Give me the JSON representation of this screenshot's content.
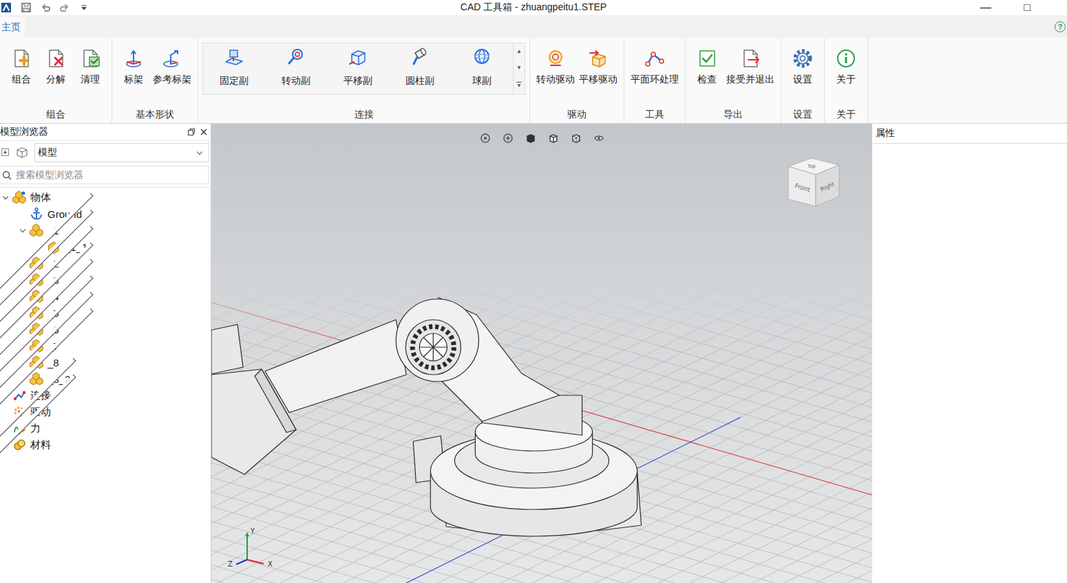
{
  "window": {
    "title": "CAD 工具箱 - zhuangpeitu1.STEP",
    "controls": [
      {
        "label": "—"
      },
      {
        "label": "□"
      }
    ]
  },
  "tabs": [
    {
      "label": "主页",
      "selected": true
    }
  ],
  "help": {
    "label": "?"
  },
  "ribbon": {
    "groups": [
      {
        "label": "组合",
        "kind": "plain",
        "buttons": [
          "组合",
          "分解",
          "清理"
        ]
      },
      {
        "label": "基本形状",
        "kind": "plain",
        "buttons": [
          "标架",
          "参考标架"
        ]
      },
      {
        "label": "连接",
        "kind": "gallery",
        "buttons": [
          "固定副",
          "转动副",
          "平移副",
          "圆柱副",
          "球副"
        ]
      },
      {
        "label": "驱动",
        "kind": "plain",
        "buttons": [
          "转动驱动",
          "平移驱动"
        ]
      },
      {
        "label": "工具",
        "kind": "plain",
        "buttons": [
          "平面环处理"
        ]
      },
      {
        "label": "导出",
        "kind": "plain",
        "buttons": [
          "检查",
          "接受并退出"
        ]
      },
      {
        "label": "设置",
        "kind": "plain",
        "buttons": [
          "设置"
        ]
      },
      {
        "label": "关于",
        "kind": "plain",
        "buttons": [
          "关于"
        ]
      }
    ],
    "gallery_scroll": [
      "▲",
      "▼",
      "▼"
    ]
  },
  "browser": {
    "title": "模型浏览器",
    "view_select": {
      "value": "模型"
    },
    "search": {
      "placeholder": "搜索模型浏览器"
    },
    "tree": [
      {
        "label": "物体",
        "level": 0,
        "kind": "bodies",
        "expandable": true,
        "expanded": true
      },
      {
        "label": "Ground",
        "level": 1,
        "kind": "ground",
        "expandable": false,
        "expanded": false
      },
      {
        "label": "_1",
        "level": 1,
        "kind": "assembly",
        "expandable": true,
        "expanded": true
      },
      {
        "label": "_1_1",
        "level": 2,
        "kind": "part",
        "expandable": false,
        "expanded": false
      },
      {
        "label": "_2",
        "level": 1,
        "kind": "assembly",
        "expandable": true,
        "expanded": false
      },
      {
        "label": "_3",
        "level": 1,
        "kind": "assembly",
        "expandable": true,
        "expanded": false
      },
      {
        "label": "_4",
        "level": 1,
        "kind": "assembly",
        "expandable": true,
        "expanded": false
      },
      {
        "label": "_5",
        "level": 1,
        "kind": "assembly",
        "expandable": true,
        "expanded": false
      },
      {
        "label": "_6",
        "level": 1,
        "kind": "assembly",
        "expandable": true,
        "expanded": false
      },
      {
        "label": "_7",
        "level": 1,
        "kind": "assembly",
        "expandable": true,
        "expanded": false
      },
      {
        "label": "_8",
        "level": 1,
        "kind": "assembly",
        "expandable": true,
        "expanded": false
      },
      {
        "label": "_8_2",
        "level": 1,
        "kind": "assembly",
        "expandable": true,
        "expanded": false
      },
      {
        "label": "连接",
        "level": 0,
        "kind": "joints",
        "expandable": false,
        "expanded": false
      },
      {
        "label": "驱动",
        "level": 0,
        "kind": "drives",
        "expandable": false,
        "expanded": false
      },
      {
        "label": "力",
        "level": 0,
        "kind": "forces",
        "expandable": true,
        "expanded": false
      },
      {
        "label": "材料",
        "level": 0,
        "kind": "materials",
        "expandable": true,
        "expanded": false
      }
    ]
  },
  "viewport": {
    "view_cube": [
      "Top",
      "Front",
      "Right"
    ],
    "axes": [
      "Y",
      "X",
      "Z"
    ]
  },
  "properties": {
    "title": "属性"
  }
}
